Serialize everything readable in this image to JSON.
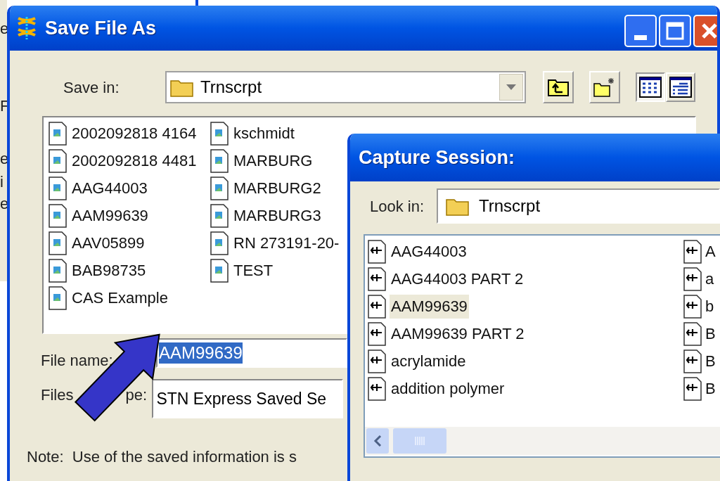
{
  "background_window": {
    "fragments": [
      "e",
      "F",
      "e",
      "i",
      "e"
    ]
  },
  "save_dialog": {
    "title": "Save File As",
    "save_in_label": "Save in:",
    "save_in": "Trnscrpt",
    "files": [
      "2002092818 4164",
      "2002092818 4481",
      "AAG44003",
      "AAM99639",
      "AAV05899",
      "BAB98735",
      "CAS Example",
      "kschmidt",
      "MARBURG",
      "MARBURG2",
      "MARBURG3",
      "RN 273191-20-",
      "TEST"
    ],
    "file_name_label": "File name:",
    "file_name": "AAM99639",
    "files_of_type_label_start": "Files",
    "files_of_type_label_end": "pe:",
    "files_of_type": "STN Express Saved Se",
    "note": "Note:  Use of the saved information is s"
  },
  "capture_dialog": {
    "title": "Capture Session:",
    "look_in_label": "Look in:",
    "look_in": "Trnscrpt",
    "files": [
      {
        "name": "AAG44003",
        "selected": false
      },
      {
        "name": "AAG44003 PART 2",
        "selected": false
      },
      {
        "name": "AAM99639",
        "selected": true
      },
      {
        "name": "AAM99639 PART 2",
        "selected": false
      },
      {
        "name": "acrylamide",
        "selected": false
      },
      {
        "name": "addition polymer",
        "selected": false
      }
    ],
    "column_2": [
      "A",
      "a",
      "b",
      "B",
      "B",
      "B"
    ]
  }
}
